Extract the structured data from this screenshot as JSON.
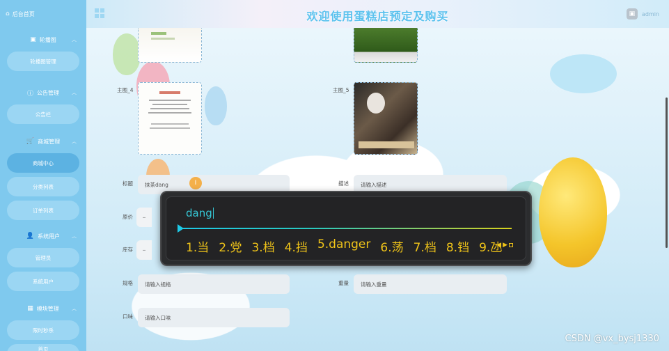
{
  "sidebar": {
    "home": "后台首页",
    "groups": [
      {
        "label": "轮播图",
        "items": [
          "轮播图管理"
        ]
      },
      {
        "label": "公告管理",
        "items": [
          "公告栏"
        ]
      },
      {
        "label": "商城管理",
        "items": [
          "商城中心",
          "分类列表",
          "订单列表"
        ]
      },
      {
        "label": "系统用户",
        "items": [
          "管理员",
          "系统用户"
        ]
      },
      {
        "label": "模块管理",
        "items": [
          "限时秒杀",
          "首页"
        ]
      }
    ]
  },
  "header": {
    "title": "欢迎使用蛋糕店预定及购买",
    "user": "admin"
  },
  "form": {
    "theme4_label": "主图_4",
    "theme5_label": "主图_5",
    "title_label": "标题",
    "title_value": "抹茶dang",
    "desc_label": "描述",
    "desc_placeholder": "请输入描述",
    "price_label": "原价",
    "stock_label": "库存",
    "spec_label": "规格",
    "spec_placeholder": "请输入规格",
    "weight_label": "重量",
    "weight_placeholder": "请输入重量",
    "taste_label": "口味",
    "taste_placeholder": "请输入口味",
    "minus": "–"
  },
  "ime": {
    "input": "dang",
    "candidates": [
      "1.当",
      "2.党",
      "3.档",
      "4.挡",
      "5.danger",
      "6.荡",
      "7.档",
      "8.铛",
      "9.氹"
    ]
  },
  "watermark": "CSDN @vx_bysj1330",
  "colors": {
    "sidebar": "#7fc9ee",
    "title": "#5cc2ee",
    "ime_candidate": "#f0c419",
    "ime_input": "#36c8d6"
  }
}
